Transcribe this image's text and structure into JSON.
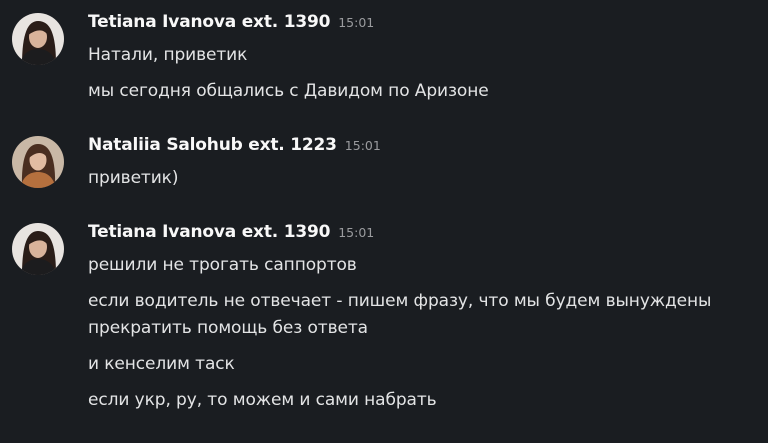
{
  "messages": [
    {
      "sender": "Tetiana Ivanova ext. 1390",
      "time": "15:01",
      "avatar_icon": "woman-dark-hair-avatar",
      "lines": [
        "Натали, приветик",
        "мы сегодня общались с Давидом по Аризоне"
      ]
    },
    {
      "sender": "Nataliia Salohub ext. 1223",
      "time": "15:01",
      "avatar_icon": "woman-brown-hair-avatar",
      "lines": [
        "приветик)"
      ]
    },
    {
      "sender": "Tetiana Ivanova ext. 1390",
      "time": "15:01",
      "avatar_icon": "woman-dark-hair-avatar",
      "lines": [
        "решили не трогать саппортов",
        "если водитель не отвечает - пишем фразу, что мы будем вынуждены прекратить помощь без ответа",
        "и кенселим таск",
        "если укр, ру, то можем и сами набрать"
      ]
    }
  ],
  "colors": {
    "background": "#1a1d21",
    "sender": "#f8f8f8",
    "text": "#e3e4e5",
    "time": "#9a9b9e"
  }
}
